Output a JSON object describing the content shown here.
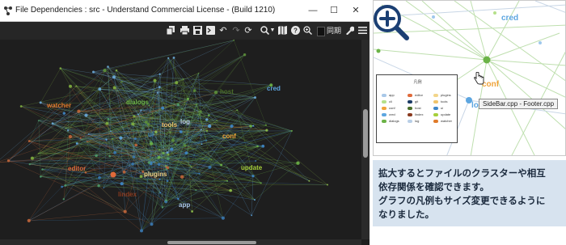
{
  "window": {
    "title": "File Dependencies : src - Understand Commercial License - (Build 1210)",
    "controls": {
      "minimize": "—",
      "maximize": "☐",
      "close": "✕"
    }
  },
  "toolbar": {
    "items": [
      "copy-icon",
      "print-icon",
      "save-icon",
      "terminal-icon",
      "undo-icon",
      "redo-icon",
      "refresh-icon",
      "search-icon",
      "dropdown-icon",
      "map-icon",
      "help-icon",
      "zoom-icon"
    ],
    "sync_label": "同期",
    "settings_icon": "wrench-icon",
    "menu_icon": "hamburger-icon"
  },
  "graph": {
    "labels": [
      {
        "text": "watcher",
        "color": "#e07b2a"
      },
      {
        "text": "dialogs",
        "color": "#6bb347"
      },
      {
        "text": "host",
        "color": "#4a6f2a"
      },
      {
        "text": "cred",
        "color": "#5da6e0"
      },
      {
        "text": "log",
        "color": "#b9cfe6"
      },
      {
        "text": "tools",
        "color": "#f0c36a"
      },
      {
        "text": "ui",
        "color": "#3f87c9"
      },
      {
        "text": "conf",
        "color": "#f0a33a"
      },
      {
        "text": "editor",
        "color": "#e06a3a"
      },
      {
        "text": "plugins",
        "color": "#f2d58a"
      },
      {
        "text": "update",
        "color": "#a6cf3a"
      },
      {
        "text": "lindex",
        "color": "#8a3a1f"
      },
      {
        "text": "app",
        "color": "#a9c8e8"
      }
    ]
  },
  "zoom_view": {
    "labels": [
      {
        "text": "cred",
        "color": "#5da6e0"
      },
      {
        "text": "conf",
        "color": "#f0a33a"
      },
      {
        "text": "log",
        "color": "#5da6e0"
      }
    ],
    "legend": {
      "title": "凡例",
      "items": [
        {
          "text": "app",
          "color": "#a9c8e8"
        },
        {
          "text": "cli",
          "color": "#b5e08a"
        },
        {
          "text": "conf",
          "color": "#f0a33a"
        },
        {
          "text": "cred",
          "color": "#5da6e0"
        },
        {
          "text": "dialogs",
          "color": "#6bb347"
        },
        {
          "text": "editor",
          "color": "#e06a3a"
        },
        {
          "text": "git",
          "color": "#1b3b66"
        },
        {
          "text": "host",
          "color": "#4a6f2a"
        },
        {
          "text": "lindex",
          "color": "#8a3a1f"
        },
        {
          "text": "log",
          "color": "#b9cfe6"
        },
        {
          "text": "plugins",
          "color": "#f2d58a"
        },
        {
          "text": "tools",
          "color": "#f0c36a"
        },
        {
          "text": "ui",
          "color": "#3f87c9"
        },
        {
          "text": "update",
          "color": "#a6cf3a"
        },
        {
          "text": "watcher",
          "color": "#e07b2a"
        }
      ]
    },
    "tooltip": "SideBar.cpp - Footer.cpp"
  },
  "caption": {
    "lines": [
      "拡大するとファイルのクラスターや相互",
      "依存関係を確認できます。",
      "グラフの凡例もサイズ変更できるように",
      "なりました。"
    ]
  }
}
